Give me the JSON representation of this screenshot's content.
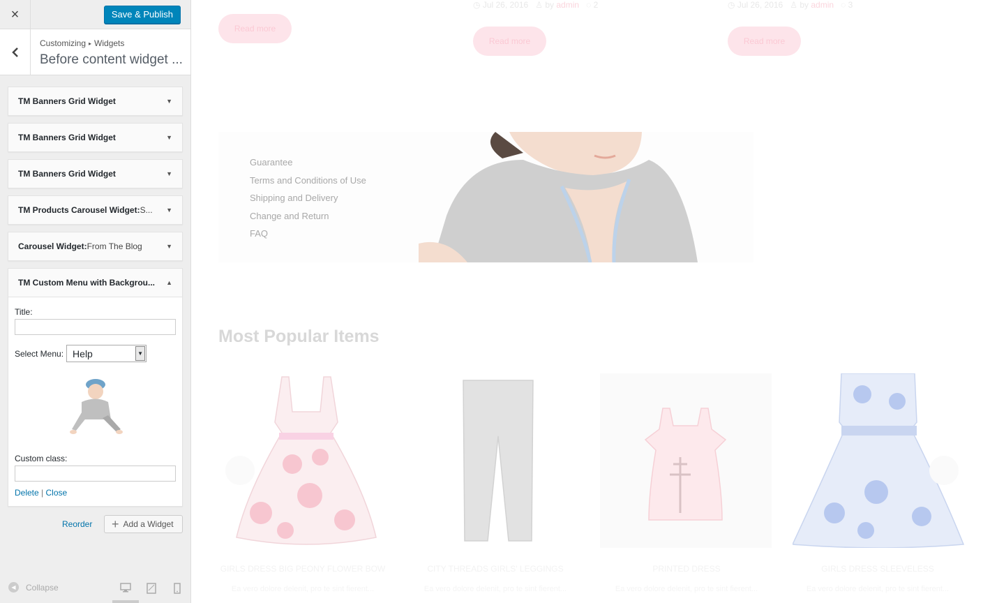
{
  "topbar": {
    "close_label": "×",
    "save_label": "Save & Publish"
  },
  "header": {
    "breadcrumb_root": "Customizing",
    "breadcrumb_leaf": "Widgets",
    "title": "Before content widget ..."
  },
  "widgets": [
    {
      "title": "TM Banners Grid Widget",
      "subtitle": ""
    },
    {
      "title": "TM Banners Grid Widget",
      "subtitle": ""
    },
    {
      "title": "TM Banners Grid Widget",
      "subtitle": ""
    },
    {
      "title": "TM Products Carousel Widget:",
      "subtitle": " S..."
    },
    {
      "title": "Carousel Widget:",
      "subtitle": " From The Blog"
    },
    {
      "title": "TM Custom Menu with Backgrou...",
      "subtitle": ""
    }
  ],
  "expanded_widget": {
    "title_label": "Title:",
    "title_value": "",
    "select_menu_label": "Select Menu:",
    "select_menu_value": "Help",
    "custom_class_label": "Custom class:",
    "custom_class_value": "",
    "delete_label": "Delete",
    "separator": "|",
    "close_label": "Close"
  },
  "actions": {
    "reorder_label": "Reorder",
    "add_widget_label": "Add a Widget"
  },
  "footer": {
    "collapse_label": "Collapse"
  },
  "preview": {
    "read_more": "Read more",
    "posts_meta": [
      {
        "date": "Jul 26, 2016",
        "by": "by",
        "author": "admin",
        "comments": "2"
      },
      {
        "date": "Jul 26, 2016",
        "by": "by",
        "author": "admin",
        "comments": "3"
      }
    ],
    "menu_items": [
      "Guarantee",
      "Terms and Conditions of Use",
      "Shipping and Delivery",
      "Change and Return",
      "FAQ"
    ],
    "popular_title": "Most Popular Items",
    "products": [
      {
        "name": "GIRLS DRESS BIG PEONY FLOWER BOW",
        "desc": "Ea vero dolore delenit, pro te sint fierent..."
      },
      {
        "name": "CITY THREADS GIRLS' LEGGINGS",
        "desc": "Ea vero dolore delenit, pro te sint fierent..."
      },
      {
        "name": "PRINTED DRESS",
        "desc": "Ea vero dolore delenit, pro te sint fierent..."
      },
      {
        "name": "GIRLS DRESS SLEEVELESS",
        "desc": "Ea vero dolore delenit, pro te sint fierent..."
      }
    ]
  }
}
